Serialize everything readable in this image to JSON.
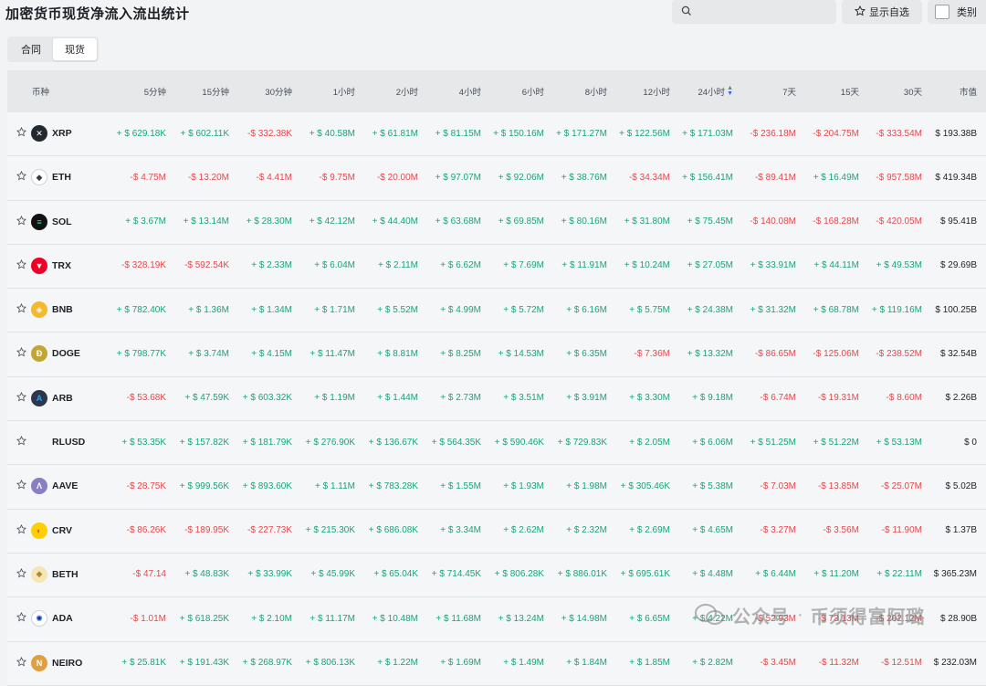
{
  "header": {
    "title": "加密货币现货净流入流出统计",
    "search_placeholder": "",
    "favorites_label": "显示自选",
    "category_label": "类别"
  },
  "tabs": [
    {
      "label": "合同",
      "active": false
    },
    {
      "label": "现货",
      "active": true
    }
  ],
  "colors": {
    "positive": "#1aa37a",
    "negative": "#e5484d",
    "sort_active": "#2a6fdb"
  },
  "columns": {
    "coin": "币种",
    "m5": "5分钟",
    "m15": "15分钟",
    "m30": "30分钟",
    "h1": "1小时",
    "h2": "2小时",
    "h4": "4小时",
    "h6": "6小时",
    "h8": "8小时",
    "h12": "12小时",
    "h24": "24小时",
    "d7": "7天",
    "d15": "15天",
    "d30": "30天",
    "mcap": "市值"
  },
  "rows": [
    {
      "coin": "XRP",
      "icon": "xrp-icon",
      "values": [
        "+ $ 629.18K",
        "+ $ 602.11K",
        "-$ 332.38K",
        "+ $ 40.58M",
        "+ $ 61.81M",
        "+ $ 81.15M",
        "+ $ 150.16M",
        "+ $ 171.27M",
        "+ $ 122.56M",
        "+ $ 171.03M",
        "-$ 236.18M",
        "-$ 204.75M",
        "-$ 333.54M"
      ],
      "mcap": "$ 193.38B"
    },
    {
      "coin": "ETH",
      "icon": "eth-icon",
      "values": [
        "-$ 4.75M",
        "-$ 13.20M",
        "-$ 4.41M",
        "-$ 9.75M",
        "-$ 20.00M",
        "+ $ 97.07M",
        "+ $ 92.06M",
        "+ $ 38.76M",
        "-$ 34.34M",
        "+ $ 156.41M",
        "-$ 89.41M",
        "+ $ 16.49M",
        "-$ 957.58M"
      ],
      "mcap": "$ 419.34B"
    },
    {
      "coin": "SOL",
      "icon": "sol-icon",
      "values": [
        "+ $ 3.67M",
        "+ $ 13.14M",
        "+ $ 28.30M",
        "+ $ 42.12M",
        "+ $ 44.40M",
        "+ $ 63.68M",
        "+ $ 69.85M",
        "+ $ 80.16M",
        "+ $ 31.80M",
        "+ $ 75.45M",
        "-$ 140.08M",
        "-$ 168.28M",
        "-$ 420.05M"
      ],
      "mcap": "$ 95.41B"
    },
    {
      "coin": "TRX",
      "icon": "trx-icon",
      "values": [
        "-$ 328.19K",
        "-$ 592.54K",
        "+ $ 2.33M",
        "+ $ 6.04M",
        "+ $ 2.11M",
        "+ $ 6.62M",
        "+ $ 7.69M",
        "+ $ 11.91M",
        "+ $ 10.24M",
        "+ $ 27.05M",
        "+ $ 33.91M",
        "+ $ 44.11M",
        "+ $ 49.53M"
      ],
      "mcap": "$ 29.69B"
    },
    {
      "coin": "BNB",
      "icon": "bnb-icon",
      "values": [
        "+ $ 782.40K",
        "+ $ 1.36M",
        "+ $ 1.34M",
        "+ $ 1.71M",
        "+ $ 5.52M",
        "+ $ 4.99M",
        "+ $ 5.72M",
        "+ $ 6.16M",
        "+ $ 5.75M",
        "+ $ 24.38M",
        "+ $ 31.32M",
        "+ $ 68.78M",
        "+ $ 119.16M"
      ],
      "mcap": "$ 100.25B"
    },
    {
      "coin": "DOGE",
      "icon": "doge-icon",
      "values": [
        "+ $ 798.77K",
        "+ $ 3.74M",
        "+ $ 4.15M",
        "+ $ 11.47M",
        "+ $ 8.81M",
        "+ $ 8.25M",
        "+ $ 14.53M",
        "+ $ 6.35M",
        "-$ 7.36M",
        "+ $ 13.32M",
        "-$ 86.65M",
        "-$ 125.06M",
        "-$ 238.52M"
      ],
      "mcap": "$ 32.54B"
    },
    {
      "coin": "ARB",
      "icon": "arb-icon",
      "values": [
        "-$ 53.68K",
        "+ $ 47.59K",
        "+ $ 603.32K",
        "+ $ 1.19M",
        "+ $ 1.44M",
        "+ $ 2.73M",
        "+ $ 3.51M",
        "+ $ 3.91M",
        "+ $ 3.30M",
        "+ $ 9.18M",
        "-$ 6.74M",
        "-$ 19.31M",
        "-$ 8.60M"
      ],
      "mcap": "$ 2.26B"
    },
    {
      "coin": "RLUSD",
      "icon": "",
      "values": [
        "+ $ 53.35K",
        "+ $ 157.82K",
        "+ $ 181.79K",
        "+ $ 276.90K",
        "+ $ 136.67K",
        "+ $ 564.35K",
        "+ $ 590.46K",
        "+ $ 729.83K",
        "+ $ 2.05M",
        "+ $ 6.06M",
        "+ $ 51.25M",
        "+ $ 51.22M",
        "+ $ 53.13M"
      ],
      "mcap": "$ 0"
    },
    {
      "coin": "AAVE",
      "icon": "aave-icon",
      "values": [
        "-$ 28.75K",
        "+ $ 999.56K",
        "+ $ 893.60K",
        "+ $ 1.11M",
        "+ $ 783.28K",
        "+ $ 1.55M",
        "+ $ 1.93M",
        "+ $ 1.98M",
        "+ $ 305.46K",
        "+ $ 5.38M",
        "-$ 7.03M",
        "-$ 13.85M",
        "-$ 25.07M"
      ],
      "mcap": "$ 5.02B"
    },
    {
      "coin": "CRV",
      "icon": "crv-icon",
      "values": [
        "-$ 86.26K",
        "-$ 189.95K",
        "-$ 227.73K",
        "+ $ 215.30K",
        "+ $ 686.08K",
        "+ $ 3.34M",
        "+ $ 2.62M",
        "+ $ 2.32M",
        "+ $ 2.69M",
        "+ $ 4.65M",
        "-$ 3.27M",
        "-$ 3.56M",
        "-$ 11.90M"
      ],
      "mcap": "$ 1.37B"
    },
    {
      "coin": "BETH",
      "icon": "beth-icon",
      "values": [
        "-$ 47.14",
        "+ $ 48.83K",
        "+ $ 33.99K",
        "+ $ 45.99K",
        "+ $ 65.04K",
        "+ $ 714.45K",
        "+ $ 806.28K",
        "+ $ 886.01K",
        "+ $ 695.61K",
        "+ $ 4.48M",
        "+ $ 6.44M",
        "+ $ 11.20M",
        "+ $ 22.11M"
      ],
      "mcap": "$ 365.23M"
    },
    {
      "coin": "ADA",
      "icon": "ada-icon",
      "values": [
        "-$ 1.01M",
        "+ $ 618.25K",
        "+ $ 2.10M",
        "+ $ 11.17M",
        "+ $ 10.48M",
        "+ $ 11.68M",
        "+ $ 13.24M",
        "+ $ 14.98M",
        "+ $ 6.65M",
        "+ $ 4.22M",
        "-$ 52.93M",
        "-$ 73.13M",
        "-$ 202.12M"
      ],
      "mcap": "$ 28.90B"
    },
    {
      "coin": "NEIRO",
      "icon": "neiro-icon",
      "values": [
        "+ $ 25.81K",
        "+ $ 191.43K",
        "+ $ 268.97K",
        "+ $ 806.13K",
        "+ $ 1.22M",
        "+ $ 1.69M",
        "+ $ 1.49M",
        "+ $ 1.84M",
        "+ $ 1.85M",
        "+ $ 2.82M",
        "-$ 3.45M",
        "-$ 11.32M",
        "-$ 12.51M"
      ],
      "mcap": "$ 232.03M"
    }
  ],
  "watermark": {
    "account": "公众号",
    "name": "币须得富阿璐"
  }
}
